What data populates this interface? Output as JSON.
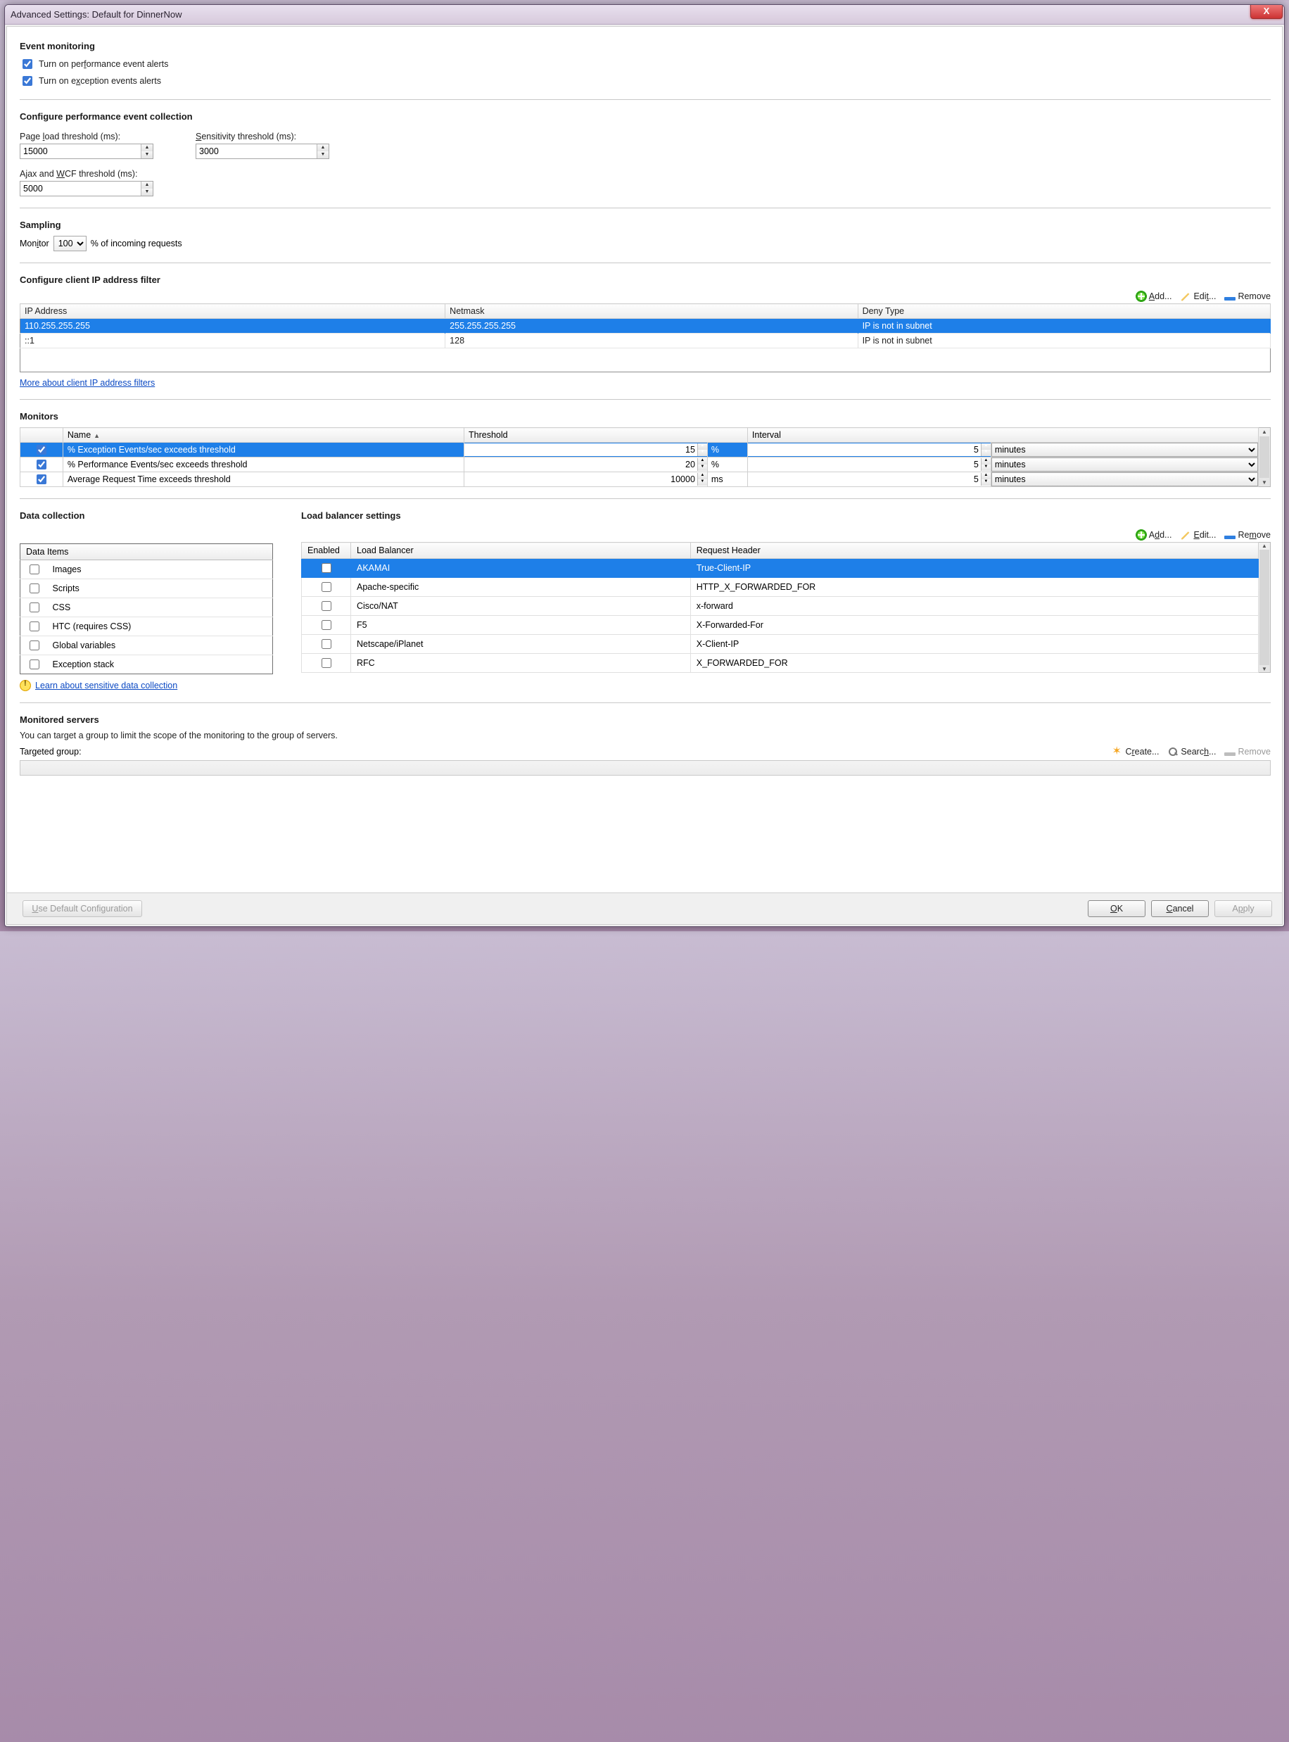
{
  "window": {
    "title": "Advanced Settings: Default for DinnerNow"
  },
  "eventMonitoring": {
    "heading": "Event monitoring",
    "perfAlertsLabel": "Turn on performance event alerts",
    "perfAlertsChecked": true,
    "excAlertsLabel": "Turn on exception events alerts",
    "excAlertsChecked": true
  },
  "perfCollection": {
    "heading": "Configure performance event collection",
    "pageLoadLabel": "Page load threshold (ms):",
    "pageLoadValue": "15000",
    "sensitivityLabel": "Sensitivity threshold (ms):",
    "sensitivityValue": "3000",
    "ajaxLabel": "Ajax and WCF threshold (ms):",
    "ajaxValue": "5000"
  },
  "sampling": {
    "heading": "Sampling",
    "prefix": "Monitor",
    "value": "100",
    "suffix": "% of incoming requests"
  },
  "ipFilter": {
    "heading": "Configure client IP address filter",
    "addLabel": "Add...",
    "editLabel": "Edit...",
    "removeLabel": "Remove",
    "cols": {
      "ip": "IP Address",
      "mask": "Netmask",
      "deny": "Deny Type"
    },
    "rows": [
      {
        "ip": "110.255.255.255",
        "mask": "255.255.255.255",
        "deny": "IP is not in subnet",
        "selected": true
      },
      {
        "ip": "::1",
        "mask": "128",
        "deny": "IP is not in subnet",
        "selected": false
      }
    ],
    "moreLink": "More about client IP address filters"
  },
  "monitors": {
    "heading": "Monitors",
    "cols": {
      "name": "Name",
      "threshold": "Threshold",
      "interval": "Interval"
    },
    "rows": [
      {
        "checked": true,
        "name": "% Exception Events/sec exceeds threshold",
        "threshold": "15",
        "tunit": "%",
        "interval": "5",
        "iunit": "minutes",
        "selected": true
      },
      {
        "checked": true,
        "name": "% Performance Events/sec exceeds threshold",
        "threshold": "20",
        "tunit": "%",
        "interval": "5",
        "iunit": "minutes",
        "selected": false
      },
      {
        "checked": true,
        "name": "Average Request Time exceeds threshold",
        "threshold": "10000",
        "tunit": "ms",
        "interval": "5",
        "iunit": "minutes",
        "selected": false
      }
    ]
  },
  "dataCollection": {
    "heading": "Data collection",
    "header": "Data Items",
    "items": [
      {
        "label": "Images",
        "checked": false
      },
      {
        "label": "Scripts",
        "checked": false
      },
      {
        "label": "CSS",
        "checked": false
      },
      {
        "label": "HTC (requires CSS)",
        "checked": false
      },
      {
        "label": "Global variables",
        "checked": false
      },
      {
        "label": "Exception stack",
        "checked": false
      }
    ],
    "learnLink": "Learn about sensitive data collection"
  },
  "loadBalancer": {
    "heading": "Load balancer settings",
    "addLabel": "Add...",
    "editLabel": "Edit...",
    "removeLabel": "Remove",
    "cols": {
      "enabled": "Enabled",
      "name": "Load Balancer",
      "header": "Request Header"
    },
    "rows": [
      {
        "checked": false,
        "name": "AKAMAI",
        "header": "True-Client-IP",
        "selected": true
      },
      {
        "checked": false,
        "name": "Apache-specific",
        "header": "HTTP_X_FORWARDED_FOR",
        "selected": false
      },
      {
        "checked": false,
        "name": "Cisco/NAT",
        "header": "x-forward",
        "selected": false
      },
      {
        "checked": false,
        "name": "F5",
        "header": "X-Forwarded-For",
        "selected": false
      },
      {
        "checked": false,
        "name": "Netscape/iPlanet",
        "header": "X-Client-IP",
        "selected": false
      },
      {
        "checked": false,
        "name": "RFC",
        "header": "X_FORWARDED_FOR",
        "selected": false
      }
    ]
  },
  "monitoredServers": {
    "heading": "Monitored servers",
    "desc": "You can target a group to limit the scope of the monitoring to the group of servers.",
    "label": "Targeted group:",
    "createLabel": "Create...",
    "searchLabel": "Search...",
    "removeLabel": "Remove"
  },
  "footer": {
    "defaultBtn": "Use Default Configuration",
    "ok": "OK",
    "cancel": "Cancel",
    "apply": "Apply"
  }
}
